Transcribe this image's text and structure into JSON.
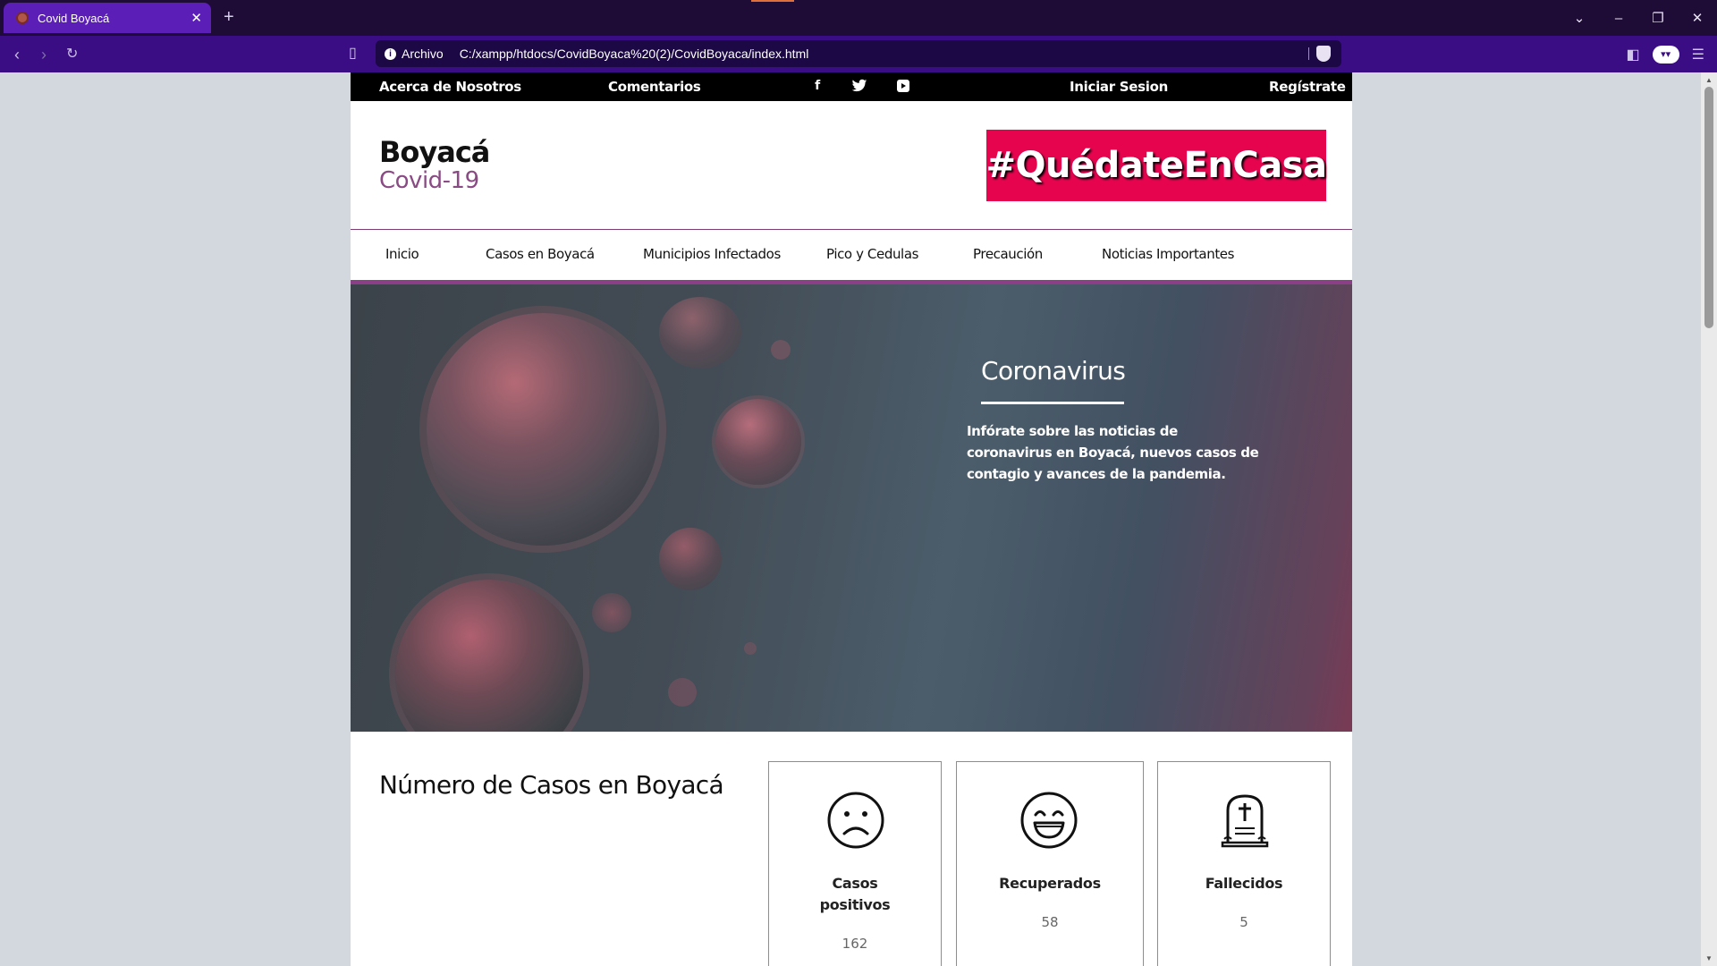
{
  "browser": {
    "tab_title": "Covid Boyacá",
    "new_tab": "+",
    "tab_close": "✕",
    "scheme_label": "Archivo",
    "url": "C:/xampp/htdocs/CovidBoyaca%20(2)/CovidBoyaca/index.html"
  },
  "topbar": {
    "about": "Acerca de Nosotros",
    "comments": "Comentarios",
    "login": "Iniciar Sesion",
    "register": "Regístrate",
    "social": [
      "facebook-icon",
      "twitter-icon",
      "youtube-icon"
    ]
  },
  "brand": {
    "title": "Boyacá",
    "subtitle": "Covid-19",
    "banner": "#QuédateEnCasa",
    "accent_color": "#8a4a84",
    "banner_color": "#e6044f"
  },
  "nav": {
    "items": [
      "Inicio",
      "Casos en Boyacá",
      "Municipios Infectados",
      "Pico y Cedulas",
      "Precaución",
      "Noticias Importantes"
    ]
  },
  "hero": {
    "title": "Coronavirus",
    "text": "Infórate sobre las noticias de coronavirus en Boyacá, nuevos casos de contagio y avances de la pandemia."
  },
  "cases": {
    "title": "Número de Casos en Boyacá",
    "cards": [
      {
        "label_line1": "Casos",
        "label_line2": "positivos",
        "value": "162",
        "icon": "sad-face-icon"
      },
      {
        "label_line1": "Recuperados",
        "value": "58",
        "icon": "happy-face-icon"
      },
      {
        "label_line1": "Fallecidos",
        "value": "5",
        "icon": "tombstone-icon"
      }
    ]
  }
}
